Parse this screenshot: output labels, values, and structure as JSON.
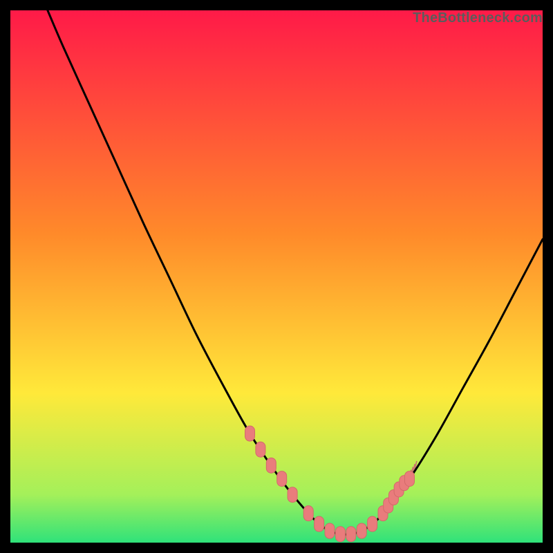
{
  "watermark": "TheBottleneck.com",
  "colors": {
    "gradient_top": "#ff1a48",
    "gradient_mid1": "#ff8a2a",
    "gradient_mid2": "#ffe93a",
    "gradient_bottom1": "#a4f05a",
    "gradient_bottom2": "#2fe27a",
    "curve": "#000000",
    "marker_fill": "#e97c7c",
    "marker_stroke": "#d36a6a",
    "hatch": "#c86f6f"
  },
  "chart_data": {
    "type": "line",
    "title": "",
    "xlabel": "",
    "ylabel": "",
    "xlim": [
      0,
      100
    ],
    "ylim": [
      0,
      100
    ],
    "series": [
      {
        "name": "bottleneck-curve",
        "x": [
          7,
          10,
          15,
          20,
          25,
          30,
          35,
          40,
          45,
          50,
          53,
          56,
          58,
          60,
          62,
          64,
          66,
          68,
          70,
          75,
          80,
          85,
          90,
          95,
          100
        ],
        "y": [
          100,
          93,
          82,
          71,
          60,
          49.5,
          39,
          29.5,
          20.5,
          13,
          9,
          5.5,
          3.5,
          2.2,
          1.6,
          1.6,
          2.2,
          3.5,
          5.5,
          12,
          20,
          29,
          38,
          47.5,
          57
        ]
      }
    ],
    "markers": {
      "name": "highlight-points",
      "x": [
        45,
        47,
        49,
        51,
        53,
        56,
        58,
        60,
        62,
        64,
        66,
        68,
        70,
        71,
        72,
        73,
        74,
        75
      ],
      "y": [
        20.5,
        17.5,
        14.5,
        12,
        9,
        5.5,
        3.5,
        2.2,
        1.6,
        1.6,
        2.2,
        3.5,
        5.5,
        7,
        8.5,
        10,
        11.2,
        12
      ]
    },
    "hatch_region": {
      "name": "right-branch-hatch",
      "x_start": 70,
      "x_end": 76
    }
  }
}
